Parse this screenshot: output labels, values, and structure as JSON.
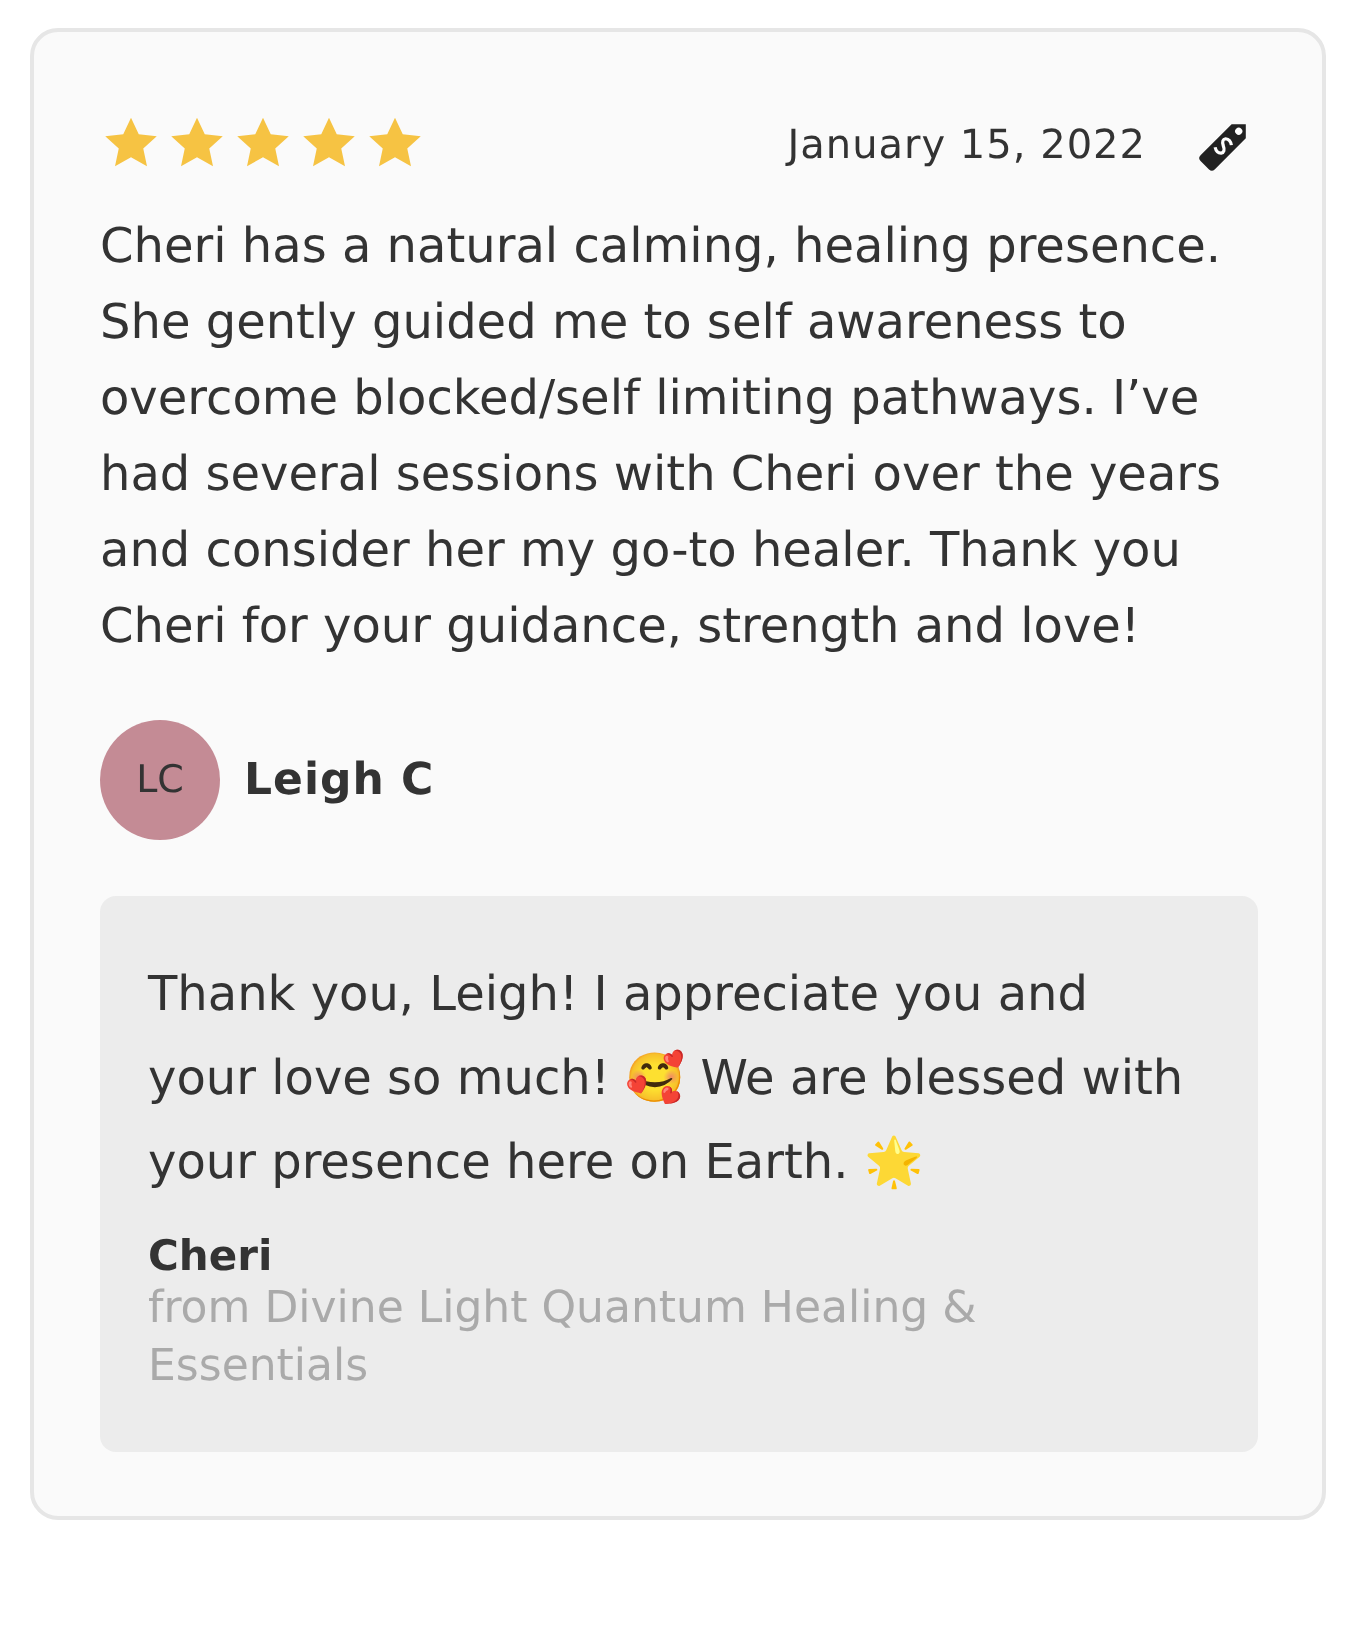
{
  "review": {
    "stars": 5,
    "date": "January 15, 2022",
    "body": "Cheri has a natural calming, healing presence. She gently guided me to self awareness to overcome blocked/self limiting pathways. I’ve had several sessions with Cheri over the years and consider her my go-to healer. Thank you Cheri for your guidance, strength and love!",
    "author": {
      "initials": "LC",
      "name": "Leigh C",
      "color": "#c48b95"
    }
  },
  "reply": {
    "body": "Thank you, Leigh! I appreciate you and your love so much! 🥰 We are blessed with your presence here on Earth. 🌟",
    "author": "Cheri",
    "source": "from Divine Light Quantum Healing & Essentials"
  }
}
